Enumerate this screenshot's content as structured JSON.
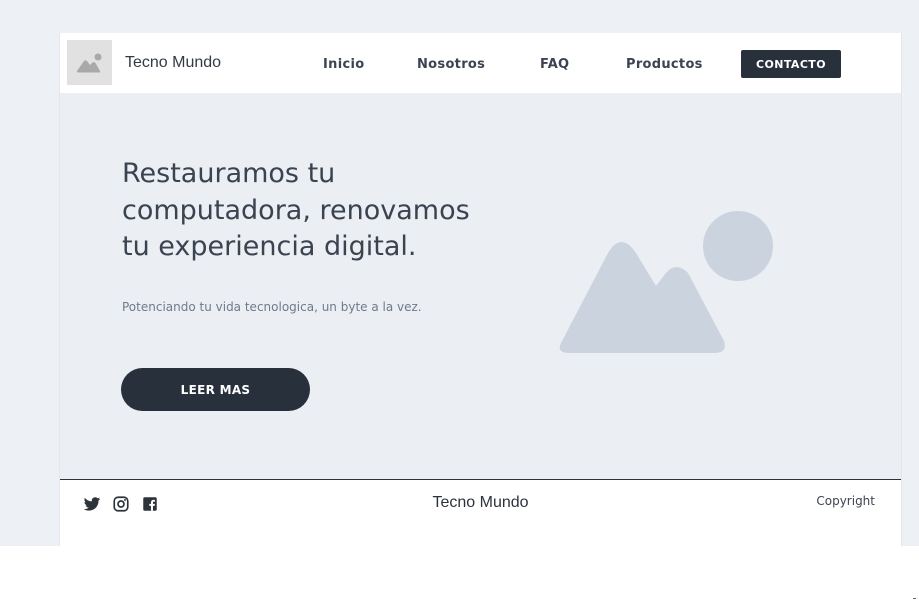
{
  "header": {
    "brand": "Tecno Mundo",
    "logo_icon": "image-placeholder-icon",
    "nav": [
      {
        "label": "Inicio"
      },
      {
        "label": "Nosotros"
      },
      {
        "label": "FAQ"
      },
      {
        "label": "Productos"
      }
    ],
    "contact_label": "CONTACTO"
  },
  "hero": {
    "title": "Restauramos tu computadora, renovamos tu experiencia digital.",
    "subtitle": "Potenciando tu vida tecnologica, un byte a la vez.",
    "cta_label": "LEER MAS",
    "image_icon": "image-placeholder-icon"
  },
  "footer": {
    "social": [
      "twitter-icon",
      "instagram-icon",
      "facebook-icon"
    ],
    "brand": "Tecno Mundo",
    "copyright": "Copyright"
  },
  "colors": {
    "page_bg": "#edf0f4",
    "hero_bg": "#ebeef3",
    "dark": "#28303c",
    "placeholder": "#cbd4de"
  }
}
